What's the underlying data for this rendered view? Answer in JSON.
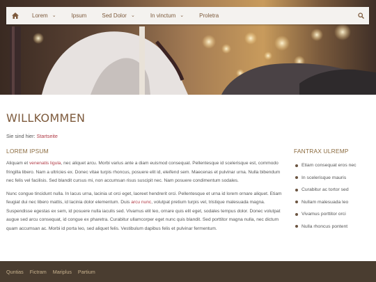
{
  "nav": {
    "items": [
      {
        "label": "Lorem",
        "dropdown": true
      },
      {
        "label": "Ipsum",
        "dropdown": false
      },
      {
        "label": "Sed Dolor",
        "dropdown": true
      },
      {
        "label": "In vinctum",
        "dropdown": true
      },
      {
        "label": "Proletra",
        "dropdown": false
      }
    ],
    "home_icon": "home-icon",
    "search_icon": "search-icon"
  },
  "page": {
    "title": "WILLKOMMEN",
    "breadcrumb_prefix": "Sie sind hier:",
    "breadcrumb_link": "Startseite"
  },
  "main": {
    "heading": "LOREM IPSUM",
    "p1": {
      "before": "Aliquam et ",
      "link": "venenatis ligula",
      "after": ", nec aliquet arcu. Morbi varius ante a diam euismod consequat. Pellentesque id scelerisque est, commodo fringilla libero. Nam a ultricies ex. Donec vitae turpis rhoncus, posuere elit id, eleifend sem. Maecenas et pulvinar urna. Nulla bibendum nec felis vel facilisis. Sed blandit cursus mi, non accumsan risus suscipit nec. Nam posuere condimentum sodales."
    },
    "p2": {
      "before": "Nunc congue tincidunt nulla. In lacus urna, lacinia ut orci eget, laoreet hendrerit orci. Pellentesque et urna id lorem ornare aliquet. Etiam feugiat dui nec libero mattis, id lacinia dolor elementum. Duis ",
      "link": "arcu nunc",
      "after": ", volutpat pretium turpis vel, tristique malesuada magna. Suspendisse egestas ex sem, id posuere nulla iaculis sed. Vivamus elit leo, ornare quis elit eget, sodales tempus dolor. Donec volutpat augue sed arcu consequat, id congue ex pharetra. Curabitur ullamcorper eget nunc quis blandit. Sed porttitor magna nulla, nec dictum quam accumsan ac. Morbi id porta leo, sed aliquet felis. Vestibulum dapibus felis et pulvinar fermentum."
    }
  },
  "sidebar": {
    "heading": "FANTRAX ULREMP",
    "items": [
      "Etiam consequat eros nec",
      "In scelerisque mauris",
      "Curabitur ac tortor sed",
      "Nullam malesuada leo",
      "Vivamus porttitor orci",
      "Nulla rhoncus pontent"
    ]
  },
  "footer": {
    "links": [
      "Quntias",
      "Fictram",
      "Mariplus",
      "Partium"
    ]
  },
  "colors": {
    "accent": "#7d5a3c",
    "link": "#b03a45",
    "footer_bg": "#4a3d30",
    "footer_link": "#c9b38f"
  }
}
